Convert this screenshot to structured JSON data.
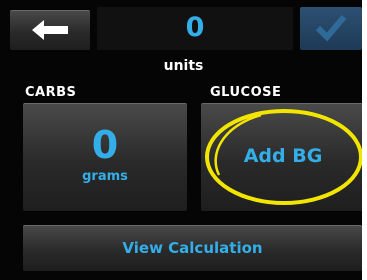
{
  "insulin": {
    "value": "0",
    "unit_label": "units"
  },
  "sections": {
    "carbs_label": "CARBS",
    "glucose_label": "GLUCOSE"
  },
  "carbs": {
    "value": "0",
    "unit": "grams"
  },
  "glucose": {
    "button_label": "Add BG"
  },
  "actions": {
    "view_calculation_label": "View Calculation",
    "back_icon": "left-arrow-icon",
    "confirm_icon": "checkmark-icon"
  },
  "colors": {
    "accent": "#34aee8",
    "highlight": "#f2e600",
    "background": "#050505",
    "confirm_bg": "#1d3a56"
  }
}
